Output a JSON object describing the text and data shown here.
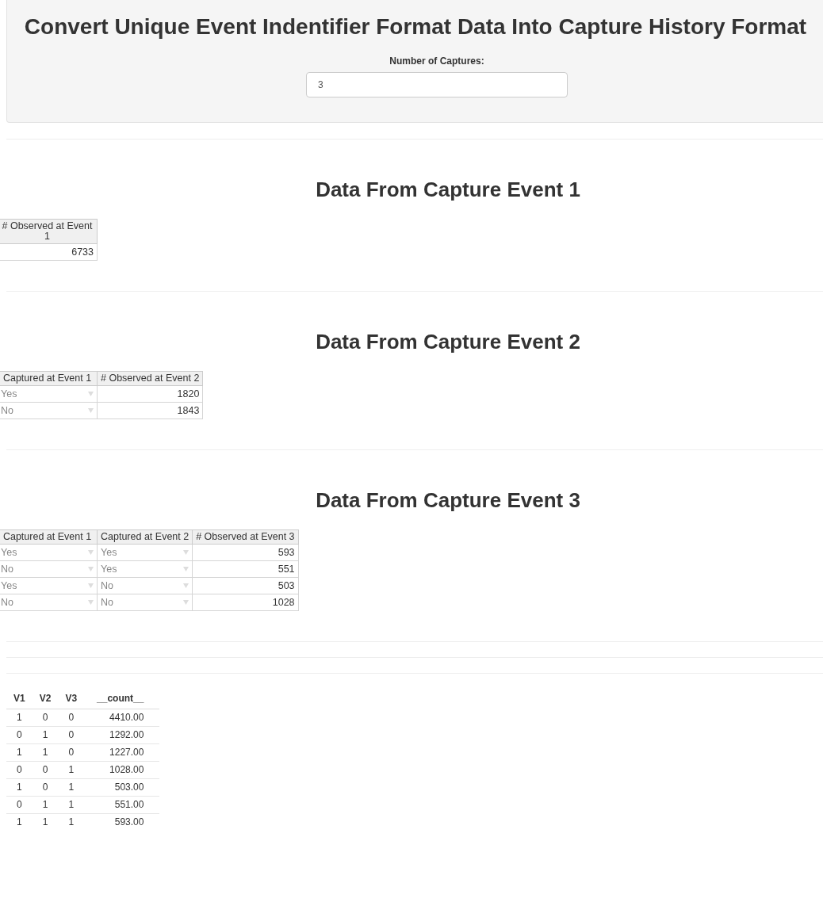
{
  "panel": {
    "title": "Convert Unique Event Indentifier Format Data Into Capture History Format",
    "captures_field": {
      "label": "Number of Captures:",
      "value": "3"
    }
  },
  "events": [
    {
      "heading": "Data From Capture Event 1",
      "columns": [
        {
          "label": "# Observed at Event 1",
          "kind": "count"
        }
      ],
      "rows": [
        [
          "6733"
        ]
      ]
    },
    {
      "heading": "Data From Capture Event 2",
      "columns": [
        {
          "label": "Captured at Event 1",
          "kind": "factor"
        },
        {
          "label": "# Observed at Event 2",
          "kind": "count"
        }
      ],
      "rows": [
        [
          "Yes",
          "1820"
        ],
        [
          "No",
          "1843"
        ]
      ]
    },
    {
      "heading": "Data From Capture Event 3",
      "columns": [
        {
          "label": "Captured at Event 1",
          "kind": "factor"
        },
        {
          "label": "Captured at Event 2",
          "kind": "factor"
        },
        {
          "label": "# Observed at Event 3",
          "kind": "count"
        }
      ],
      "rows": [
        [
          "Yes",
          "Yes",
          "593"
        ],
        [
          "No",
          "Yes",
          "551"
        ],
        [
          "Yes",
          "No",
          "503"
        ],
        [
          "No",
          "No",
          "1028"
        ]
      ]
    }
  ],
  "summary_table": {
    "columns": [
      "V1",
      "V2",
      "V3",
      "__count__"
    ],
    "rows": [
      [
        "1",
        "0",
        "0",
        "4410.00"
      ],
      [
        "0",
        "1",
        "0",
        "1292.00"
      ],
      [
        "1",
        "1",
        "0",
        "1227.00"
      ],
      [
        "0",
        "0",
        "1",
        "1028.00"
      ],
      [
        "1",
        "0",
        "1",
        "503.00"
      ],
      [
        "0",
        "1",
        "1",
        "551.00"
      ],
      [
        "1",
        "1",
        "1",
        "593.00"
      ]
    ]
  }
}
